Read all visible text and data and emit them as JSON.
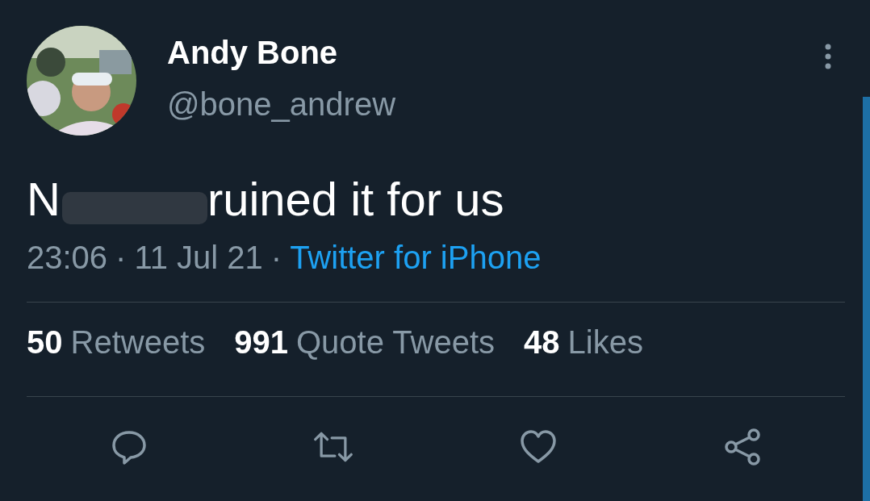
{
  "author": {
    "name": "Andy Bone",
    "handle": "@bone_andrew"
  },
  "tweet": {
    "parts": [
      {
        "kind": "text",
        "text": "N"
      },
      {
        "kind": "redaction"
      },
      {
        "kind": "text",
        "text": "ruined it for us"
      }
    ]
  },
  "meta": {
    "time": "23:06",
    "separator": "·",
    "date": "11 Jul 21",
    "separator_2": "·",
    "source": "Twitter for iPhone"
  },
  "stats": [
    {
      "count": "50",
      "label": "Retweets"
    },
    {
      "count": "991",
      "label": "Quote Tweets"
    },
    {
      "count": "48",
      "label": "Likes"
    }
  ],
  "actions": [
    {
      "kind": "reply"
    },
    {
      "kind": "retweet"
    },
    {
      "kind": "like"
    },
    {
      "kind": "share"
    }
  ]
}
